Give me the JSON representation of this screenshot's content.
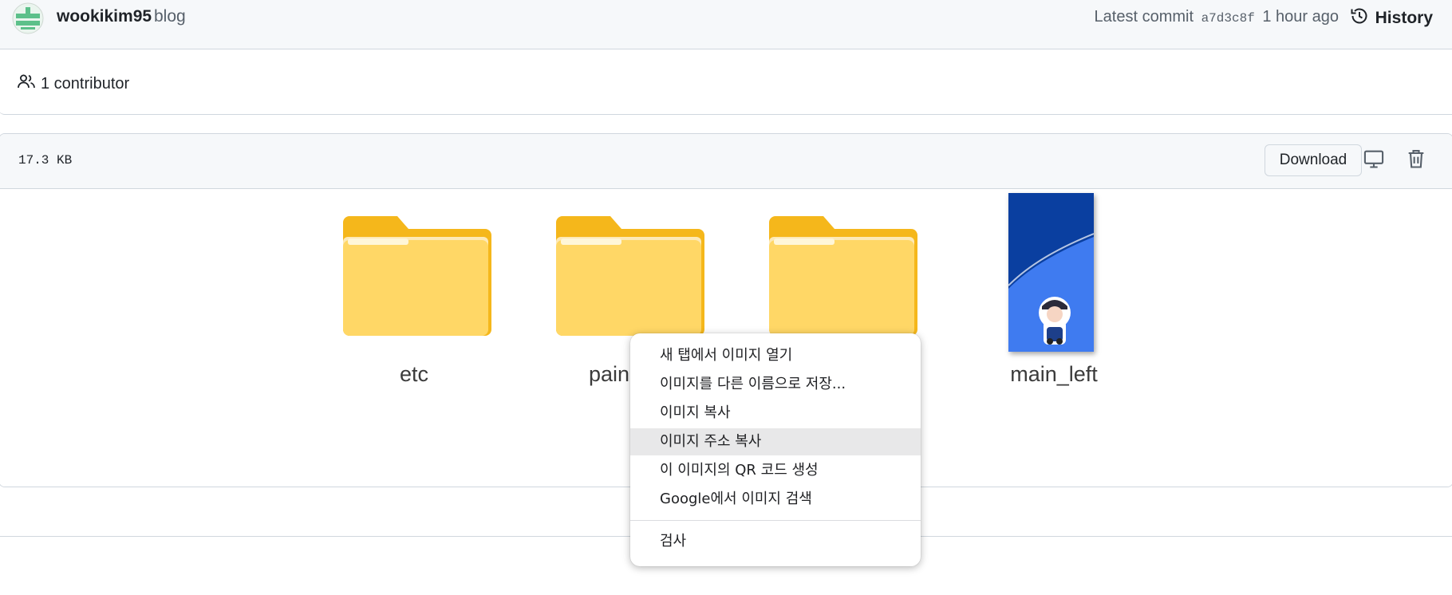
{
  "commit": {
    "author": "wookikim95",
    "message": "blog",
    "latest_label": "Latest commit",
    "hash": "a7d3c8f",
    "time": "1 hour ago",
    "history_label": "History"
  },
  "contributors": {
    "label": "1 contributor",
    "icon": "people-icon"
  },
  "file": {
    "size": "17.3 KB",
    "download_label": "Download",
    "icons": [
      "desktop-icon",
      "trash-icon"
    ]
  },
  "preview": {
    "folders": [
      {
        "label": "etc"
      },
      {
        "label": "pain"
      },
      {
        "label": ""
      }
    ],
    "image_label": "main_left"
  },
  "context_menu": {
    "items": [
      {
        "label": "새 탭에서 이미지 열기"
      },
      {
        "label": "이미지를 다른 이름으로 저장..."
      },
      {
        "label": "이미지 복사"
      },
      {
        "label": "이미지 주소 복사",
        "highlighted": true
      },
      {
        "label": "이 이미지의 QR 코드 생성"
      },
      {
        "label": "Google에서 이미지 검색"
      },
      {
        "label": "검사"
      }
    ]
  },
  "colors": {
    "folder_front": "#ffd766",
    "folder_back": "#f5b71b",
    "thumb_dark": "#0a3fa0",
    "thumb_light": "#3f7bf0",
    "menu_highlight": "#e8e8e9"
  }
}
